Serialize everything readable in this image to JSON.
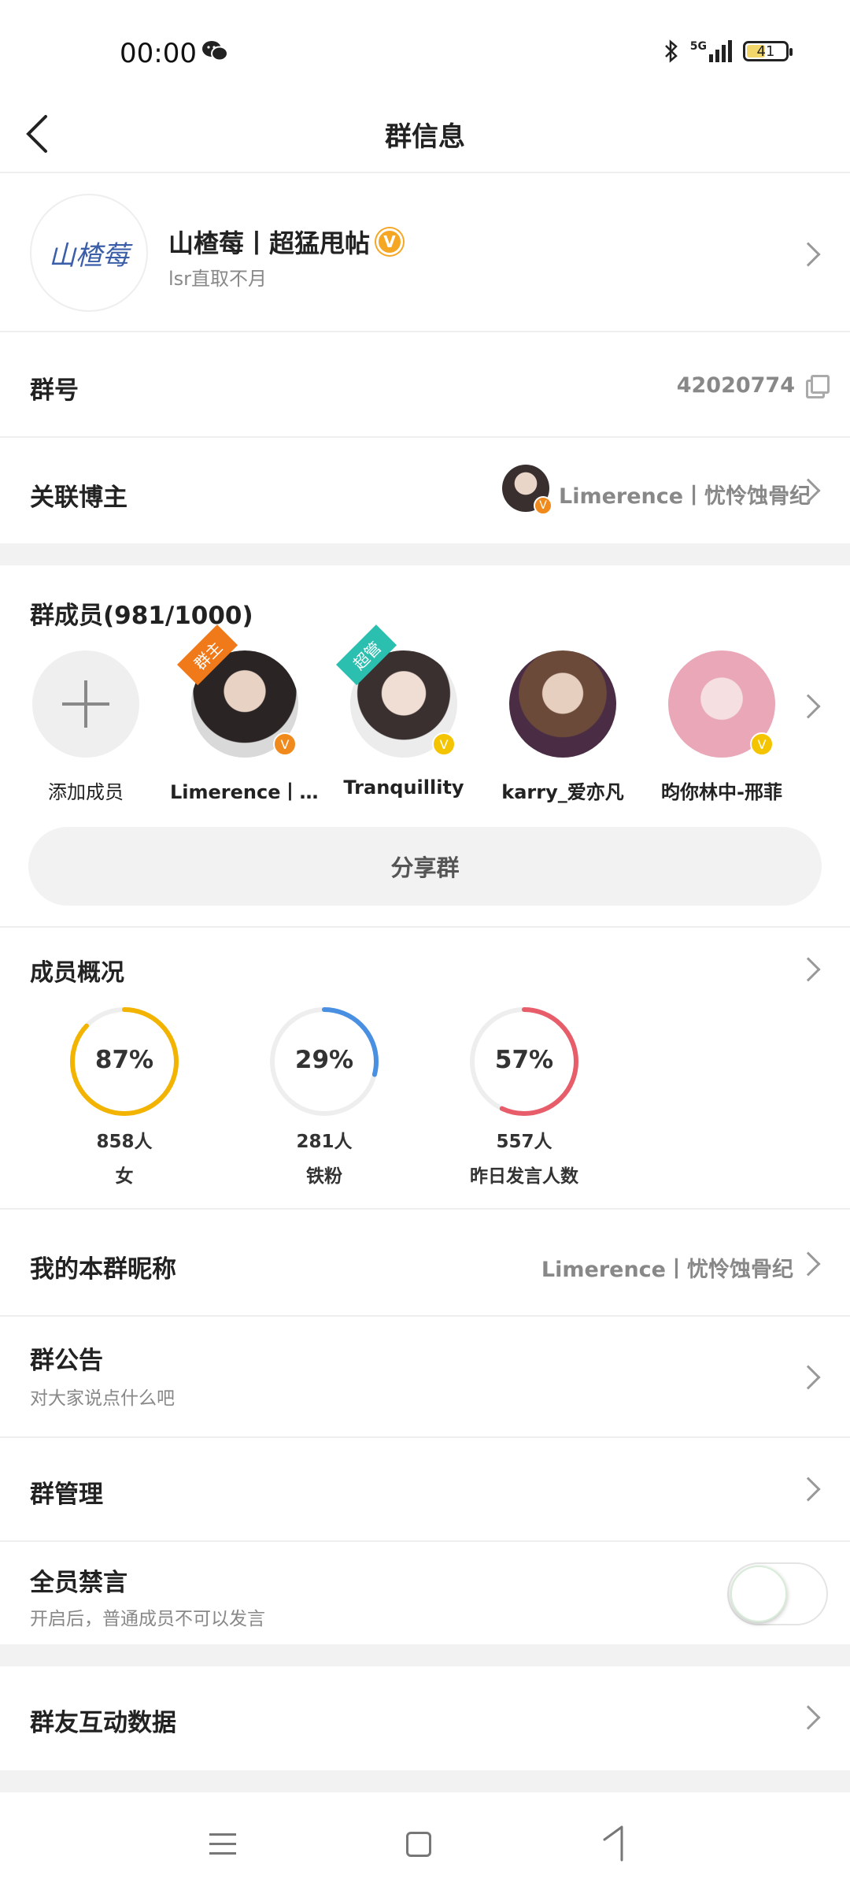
{
  "status_bar": {
    "time": "00:00",
    "network": "5G",
    "battery": "41"
  },
  "header": {
    "title": "群信息"
  },
  "group": {
    "name": "山楂莓丨超猛甩帖",
    "subtitle": "lsr直取不月",
    "logo_text": "山楂莓",
    "badge": "V"
  },
  "group_number": {
    "label": "群号",
    "value": "42020774"
  },
  "linked_blogger": {
    "label": "关联博主",
    "value": "Limerence丨忧怜蚀骨纪"
  },
  "members": {
    "heading": "群成员(981/1000)",
    "add_label": "添加成员",
    "list": [
      {
        "name": "Limerence丨忧怜蚀骨纪",
        "role": "群主",
        "role_color": "#f07a1a",
        "verified": "V"
      },
      {
        "name": "Tranquillity",
        "role": "超管",
        "role_color": "#2bbfb0",
        "verified": "V"
      },
      {
        "name": "karry_爱亦凡",
        "role": "",
        "role_color": "",
        "verified": ""
      },
      {
        "name": "昀你林中-邢菲",
        "role": "",
        "role_color": "",
        "verified": "V"
      }
    ],
    "share_label": "分享群"
  },
  "overview": {
    "heading": "成员概况",
    "stats": [
      {
        "percent_label": "87%",
        "percent": 0.87,
        "count": "858人",
        "caption": "女",
        "color": "#f2b400"
      },
      {
        "percent_label": "29%",
        "percent": 0.29,
        "count": "281人",
        "caption": "铁粉",
        "color": "#4a90e2"
      },
      {
        "percent_label": "57%",
        "percent": 0.57,
        "count": "557人",
        "caption": "昨日发言人数",
        "color": "#e85d6a"
      }
    ]
  },
  "my_nickname": {
    "label": "我的本群昵称",
    "value": "Limerence丨忧怜蚀骨纪"
  },
  "announcement": {
    "label": "群公告",
    "sub": "对大家说点什么吧"
  },
  "management": {
    "label": "群管理"
  },
  "mute_all": {
    "label": "全员禁言",
    "sub": "开启后，普通成员不可以发言",
    "enabled": false
  },
  "interaction": {
    "label": "群友互动数据"
  }
}
